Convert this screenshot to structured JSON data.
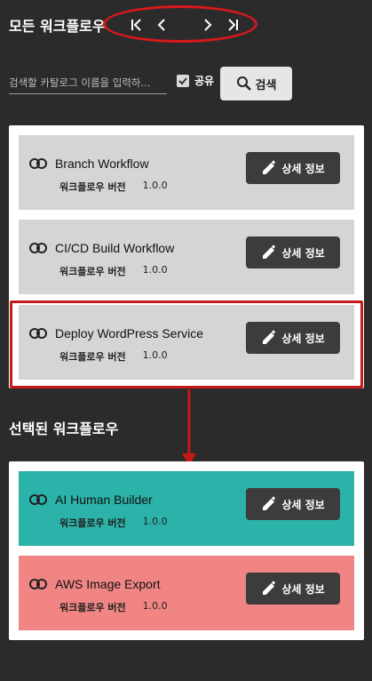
{
  "header": {
    "all_workflows_title": "모든 워크플로우"
  },
  "search": {
    "placeholder": "검색할 카탈로그 이름을 입력하...",
    "share_label": "공유",
    "share_checked": true,
    "button_label": "검색"
  },
  "meta_key": "워크플로우 버전",
  "all_workflows": [
    {
      "name": "Branch Workflow",
      "version": "1.0.0",
      "button": "상세 정보",
      "bg": "#d5d5d5"
    },
    {
      "name": "CI/CD Build Workflow",
      "version": "1.0.0",
      "button": "상세 정보",
      "bg": "#d5d5d5"
    },
    {
      "name": "Deploy WordPress Service",
      "version": "1.0.0",
      "button": "상세 정보",
      "bg": "#d5d5d5"
    }
  ],
  "selected_title": "선택된 워크플로우",
  "selected_workflows": [
    {
      "name": "AI Human Builder",
      "version": "1.0.0",
      "button": "상세 정보",
      "bg": "#2bb3a9"
    },
    {
      "name": "AWS Image Export",
      "version": "1.0.0",
      "button": "상세 정보",
      "bg": "#f08584"
    }
  ],
  "colors": {
    "background": "#2b2b2b",
    "annotation": "#d7191c",
    "button_dark": "#3c3c3c"
  }
}
